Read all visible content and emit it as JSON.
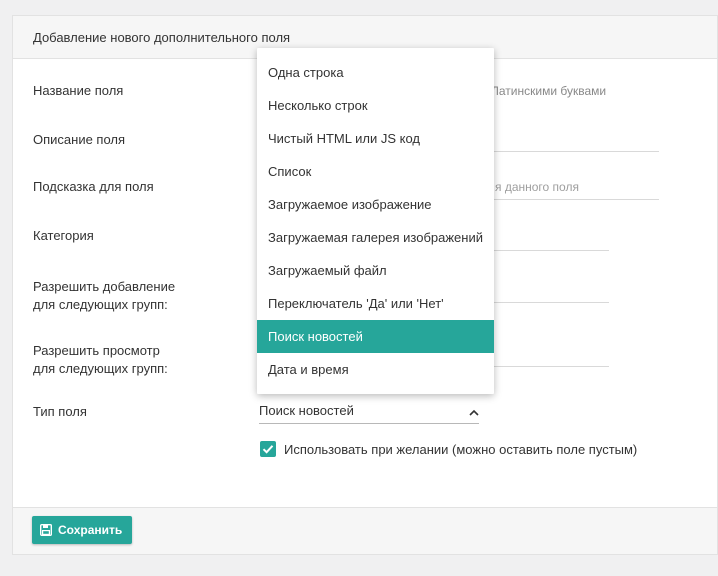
{
  "panel": {
    "title": "Добавление нового дополнительного поля"
  },
  "form": {
    "field_name_label": "Название поля",
    "field_name_hint": "Латинскими буквами",
    "description_label": "Описание поля",
    "tooltip_label": "Подсказка для поля",
    "tooltip_placeholder_fragment": "я данного поля",
    "category_label": "Категория",
    "allow_add_label_line1": "Разрешить добавление",
    "allow_add_label_line2": "для следующих групп:",
    "allow_view_label_line1": "Разрешить просмотр",
    "allow_view_label_line2": "для следующих групп:",
    "field_type_label": "Тип поля",
    "field_type_value": "Поиск новостей",
    "optional_checkbox_label": "Использовать при желании (можно оставить поле пустым)",
    "optional_checked": true
  },
  "dropdown": {
    "options": [
      "Одна строка",
      "Несколько строк",
      "Чистый HTML или JS код",
      "Список",
      "Загружаемое изображение",
      "Загружаемая галерея изображений",
      "Загружаемый файл",
      "Переключатель 'Да' или 'Нет'",
      "Поиск новостей",
      "Дата и время"
    ],
    "selected": "Поиск новостей"
  },
  "footer": {
    "save_label": "Сохранить",
    "save_icon": "floppy-disk-icon"
  },
  "colors": {
    "accent": "#26a69a",
    "background": "#f0f0f1",
    "panel": "#ffffff"
  }
}
